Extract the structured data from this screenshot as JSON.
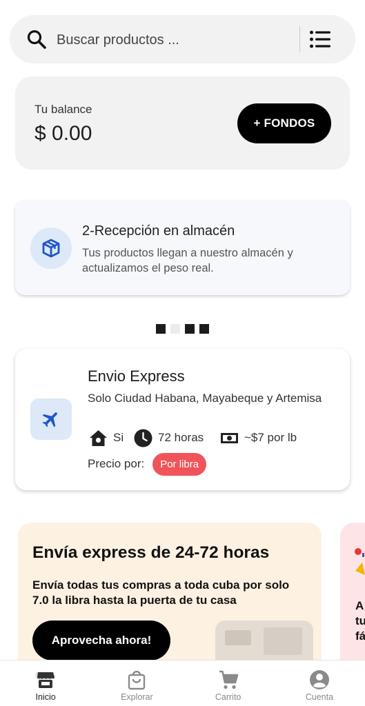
{
  "search": {
    "placeholder": "Buscar productos ..."
  },
  "balance": {
    "label": "Tu balance",
    "amount": "$ 0.00",
    "add_funds_label": "+ FONDOS"
  },
  "step_card": {
    "title": "2-Recepción en almacén",
    "description": "Tus productos llegan a nuestro almacén y actualizamos el peso real."
  },
  "carousel": {
    "total": 4,
    "active": 1
  },
  "shipping": {
    "title": "Envio Express",
    "zone": "Solo Ciudad Habana, Mayabeque y Artemisa",
    "home_delivery": "Si",
    "duration": "72 horas",
    "cost": "~$7 por lb",
    "price_by_label": "Precio por:",
    "price_by_value": "Por libra"
  },
  "promo": {
    "title": "Envía express de 24-72 horas",
    "text": "Envía todas tus compras a toda cuba por solo 7.0 la libra hasta la puerta de tu casa",
    "cta_label": "Aprovecha ahora!",
    "next_card_text": "A\ntu\nfá"
  },
  "bottom_nav": [
    {
      "label": "Inicio",
      "icon": "store-icon",
      "active": true
    },
    {
      "label": "Explorar",
      "icon": "shopping-bag-icon",
      "active": false
    },
    {
      "label": "Carrito",
      "icon": "cart-icon",
      "active": false
    },
    {
      "label": "Cuenta",
      "icon": "account-icon",
      "active": false
    }
  ],
  "colors": {
    "accent_pill": "#f0545b",
    "icon_blue": "#1f56c9",
    "icon_bg": "#dde8f8",
    "promo_bg": "#fdf1e2"
  }
}
